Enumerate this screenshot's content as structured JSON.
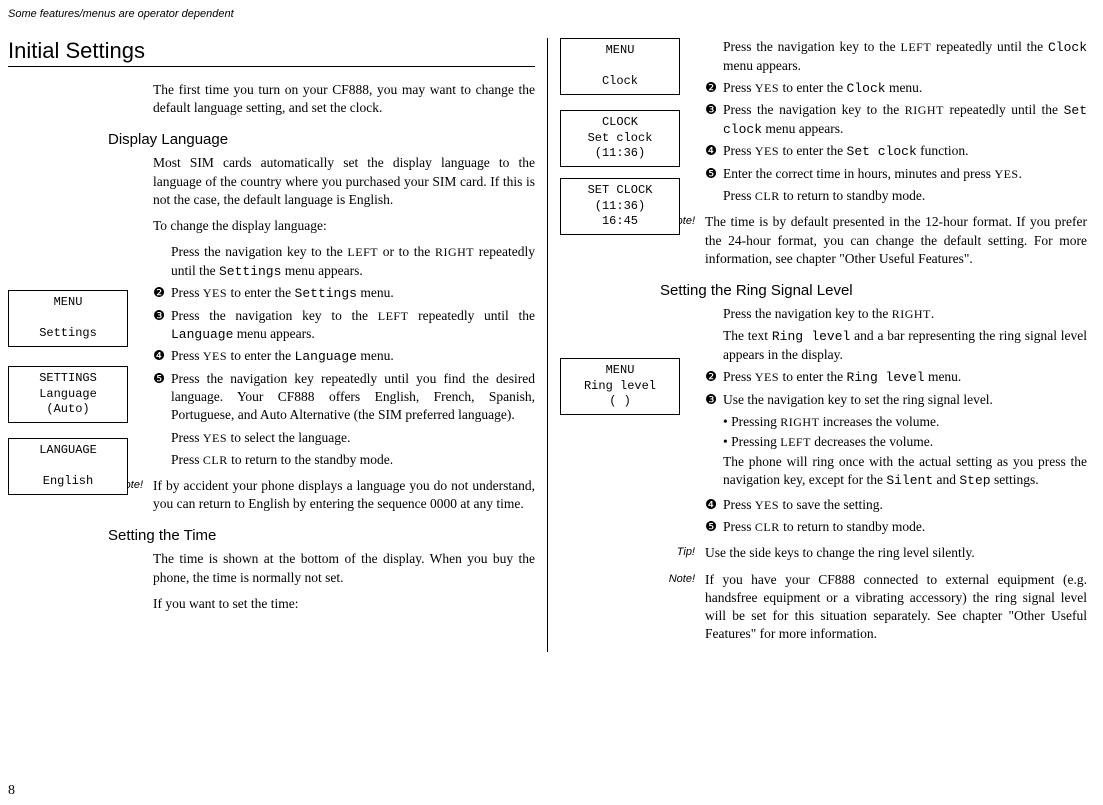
{
  "top_note": "Some features/menus are operator dependent",
  "page_number": "8",
  "left": {
    "h1": "Initial Settings",
    "intro": "The first time you turn on your CF888, you may want to change the default language setting, and set the clock.",
    "display_language": {
      "heading": "Display Language",
      "p1": "Most SIM cards automatically set the display language to the language of the country where you purchased your SIM card. If this is not the case, the default language is English.",
      "p2": "To change the display language:",
      "step1a": "Press the navigation key to the ",
      "step1b": " or to the ",
      "step1c": " repeatedly until the ",
      "step1d": " menu appears.",
      "step2a": "Press ",
      "step2b": " to enter the ",
      "step2c": " menu.",
      "step3a": "Press the navigation key to the ",
      "step3b": " repeatedly until the ",
      "step3c": " menu appears.",
      "step4a": "Press ",
      "step4b": " to enter the ",
      "step4c": " menu.",
      "step5": "Press the navigation key repeatedly until you find the desired language. Your CF888 offers English, French, Spanish,  Portuguese, and Auto Alternative (the SIM preferred language).",
      "step_sel_a": "Press ",
      "step_sel_b": " to select the language.",
      "step_clr_a": "Press ",
      "step_clr_b": " to return to the standby mode.",
      "note": "If by accident your phone displays a language you do not understand, you can return to English by entering the sequence     0000      at any time."
    },
    "setting_time": {
      "heading": "Setting the Time",
      "p1": "The time is shown at the bottom of the display. When you buy the phone, the time is normally not set.",
      "p2": "If you want to set the time:"
    },
    "screens": {
      "menu_settings_l1": "MENU",
      "menu_settings_l2": "Settings",
      "settings_lang_l1": "SETTINGS",
      "settings_lang_l2": "Language",
      "settings_lang_l3": "(Auto)",
      "lang_l1": "LANGUAGE",
      "lang_l2": "English"
    },
    "keys": {
      "left": "LEFT",
      "right": "RIGHT",
      "yes": "YES",
      "clr": "CLR"
    },
    "menus": {
      "settings": "Settings",
      "language": "Language"
    }
  },
  "right": {
    "screens": {
      "menu_clock_l1": "MENU",
      "menu_clock_l2": "Clock",
      "clock_l1": "CLOCK",
      "clock_l2": "Set clock",
      "clock_l3": "(11:36)",
      "setclock_l1": "SET CLOCK",
      "setclock_l2": "(11:36)",
      "setclock_l3": "16:45",
      "ring_l1": "MENU",
      "ring_l2": "Ring level",
      "ring_l3": "(      )"
    },
    "clock": {
      "step1a": "Press the navigation key to the ",
      "step1b": " repeatedly until the ",
      "step1c": " menu appears.",
      "step2a": "Press ",
      "step2b": " to enter the ",
      "step2c": " menu.",
      "step3a": "Press the navigation key to the ",
      "step3b": " repeatedly until the ",
      "step3c": " menu appears.",
      "step4a": "Press ",
      "step4b": " to enter the ",
      "step4c": " function.",
      "step5a": "Enter the correct time in hours, minutes and press ",
      "step5b": ".",
      "step_clr_a": "Press ",
      "step_clr_b": " to return to standby mode.",
      "note": "The time is by default presented in the 12-hour format. If you prefer the 24-hour format, you can change the default setting. For more information, see chapter \"Other Useful Features\"."
    },
    "menus": {
      "clock": "Clock",
      "set_clock": "Set clock",
      "ring_level": "Ring level",
      "silent": "Silent",
      "step": "Step"
    },
    "ring": {
      "heading": "Setting the Ring Signal Level",
      "step1a": "Press the navigation key to the ",
      "step1b": ".",
      "step1c_a": "The text ",
      "step1c_b": " and a bar representing the ring signal level appears in the display.",
      "step2a": "Press ",
      "step2b": " to enter the ",
      "step2c": "  menu.",
      "step3": "Use the navigation key to set the ring signal level.",
      "bullet1a": "•  Pressing ",
      "bullet1b": " increases the volume.",
      "bullet2a": "•  Pressing ",
      "bullet2b": " decreases the volume.",
      "sub_a": "The phone will ring once with the actual setting as you press the navigation key, except for the ",
      "sub_b": " and ",
      "sub_c": " settings.",
      "step4a": "Press ",
      "step4b": " to save the setting.",
      "step5a": "Press ",
      "step5b": " to return to standby mode.",
      "tip": "Use the side keys to change the ring level silently.",
      "note": "If you have your CF888 connected to external equipment (e.g. handsfree equipment or a vibrating accessory) the ring signal level will be set for this situation separately. See chapter \"Other Useful Features\" for more information."
    },
    "keys": {
      "left": "LEFT",
      "right": "RIGHT",
      "yes": "YES",
      "clr": "CLR"
    },
    "labels": {
      "note": "Note!",
      "tip": "Tip!"
    }
  },
  "labels": {
    "note": "Note!"
  }
}
